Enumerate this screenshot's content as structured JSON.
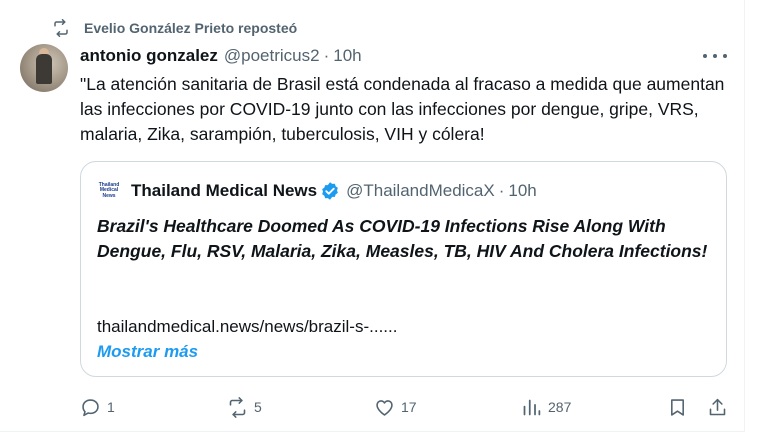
{
  "repost": {
    "icon": "repost-icon",
    "label": "Evelio González Prieto reposteó"
  },
  "tweet": {
    "author_name": "antonio gonzalez",
    "author_handle": "@poetricus2",
    "separator": "·",
    "time": "10h",
    "text": "\"La atención sanitaria de Brasil está condenada al fracaso a medida que aumentan las infecciones por COVID-19 junto con las infecciones por dengue, gripe, VRS, malaria, Zika, sarampión, tuberculosis, VIH y cólera!"
  },
  "quote": {
    "logo_lines": [
      "Thailand",
      "Medical",
      "News"
    ],
    "author_name": "Thailand Medical News",
    "author_handle": "@ThailandMedicaX",
    "separator": "·",
    "time": "10h",
    "title": "Brazil's Healthcare Doomed As COVID-19 Infections Rise Along With Dengue, Flu, RSV, Malaria, Zika, Measles, TB, HIV And Cholera Infections!",
    "link": "thailandmedical.news/news/brazil-s-......",
    "show_more": "Mostrar más"
  },
  "actions": {
    "replies": "1",
    "reposts": "5",
    "likes": "17",
    "views": "287"
  },
  "colors": {
    "text": "#0f1419",
    "muted": "#536471",
    "accent": "#1d9bf0",
    "border": "#cfd9de"
  }
}
